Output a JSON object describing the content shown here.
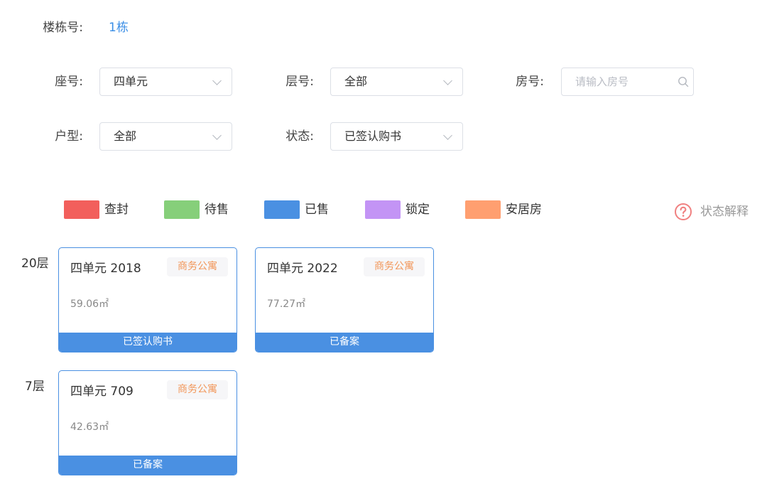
{
  "building": {
    "label": "楼栋号:",
    "value": "1栋"
  },
  "filters": {
    "seat": {
      "label": "座号:",
      "value": "四单元"
    },
    "floor": {
      "label": "层号:",
      "value": "全部"
    },
    "room": {
      "label": "房号:",
      "placeholder": "请输入房号"
    },
    "layout": {
      "label": "户型:",
      "value": "全部"
    },
    "status": {
      "label": "状态:",
      "value": "已签认购书"
    }
  },
  "legend": [
    {
      "label": "查封",
      "color": "#f25f5c"
    },
    {
      "label": "待售",
      "color": "#86cf7a"
    },
    {
      "label": "已售",
      "color": "#4a90e2"
    },
    {
      "label": "锁定",
      "color": "#c394f5"
    },
    {
      "label": "安居房",
      "color": "#ff9f70"
    }
  ],
  "status_help": {
    "label": "状态解释",
    "icon": "question-circle-icon",
    "color": "#f08080"
  },
  "floors": [
    {
      "label": "20层",
      "units": [
        {
          "name": "四单元 2018",
          "tag": "商务公寓",
          "area": "59.06㎡",
          "status": "已签认购书"
        },
        {
          "name": "四单元 2022",
          "tag": "商务公寓",
          "area": "77.27㎡",
          "status": "已备案"
        }
      ]
    },
    {
      "label": "7层",
      "units": [
        {
          "name": "四单元 709",
          "tag": "商务公寓",
          "area": "42.63㎡",
          "status": "已备案"
        }
      ]
    }
  ],
  "colors": {
    "accent": "#4a90e2",
    "link": "#3a8ee6",
    "tag_text": "#f2975a"
  }
}
